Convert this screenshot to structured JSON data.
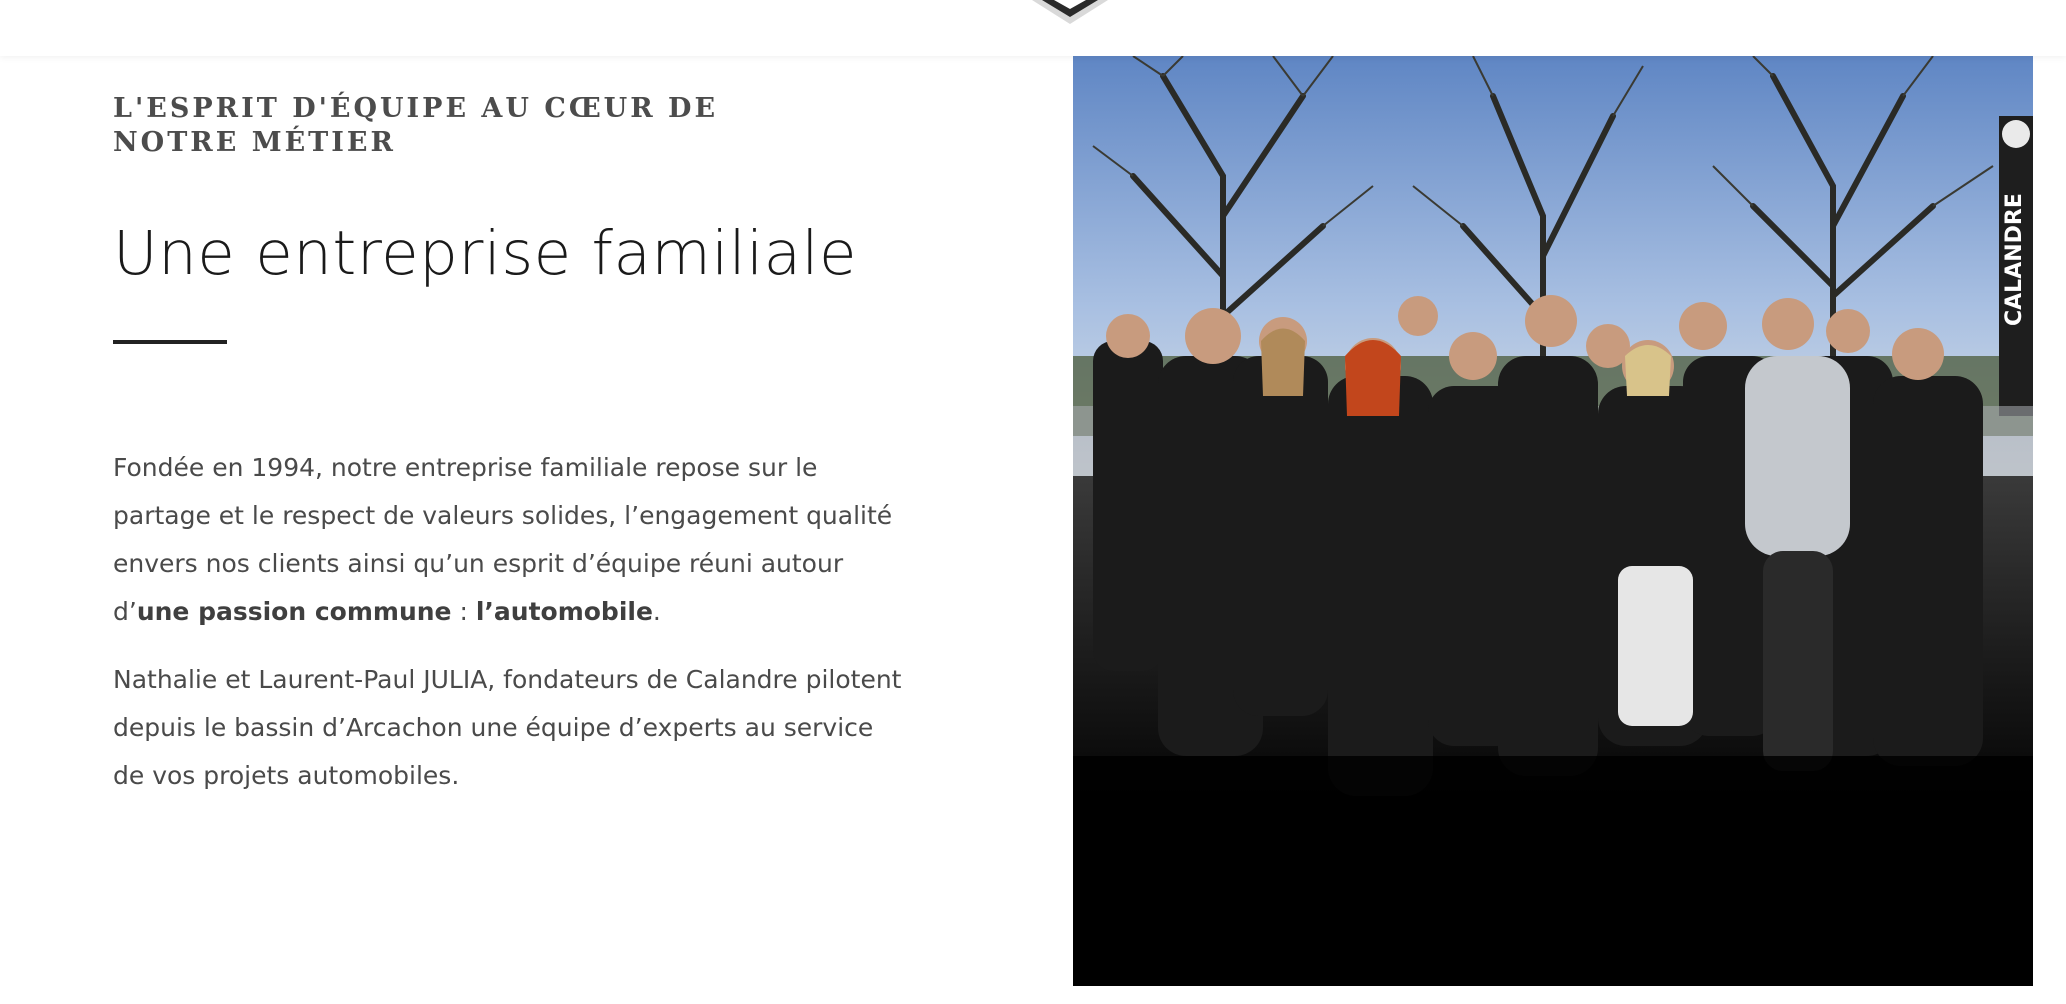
{
  "header": {
    "logo_icon": "calandre-shield-logo-icon"
  },
  "section": {
    "eyebrow": "L'ESPRIT D'ÉQUIPE AU CŒUR DE NOTRE MÉTIER",
    "title": "Une entreprise familiale",
    "paragraph1": {
      "before": "Fondée en 1994, notre entreprise familiale repose sur le partage et le respect de valeurs solides, l’engagement qualité envers nos clients ainsi qu’un esprit d’équipe réuni autour d’",
      "bold1": "une passion commune",
      "middle": " : ",
      "bold2": "l’automobile",
      "after": "."
    },
    "paragraph2": "Nathalie et Laurent-Paul JULIA, fondateurs de Calandre pilotent depuis le bassin d’Arcachon une équipe d’experts au service de vos projets automobiles."
  },
  "photo": {
    "sign_text": "CALANDRE",
    "colors": {
      "sky": "#7fa3d6",
      "ground": "#000000",
      "clothing": "#1b1b1b"
    }
  }
}
